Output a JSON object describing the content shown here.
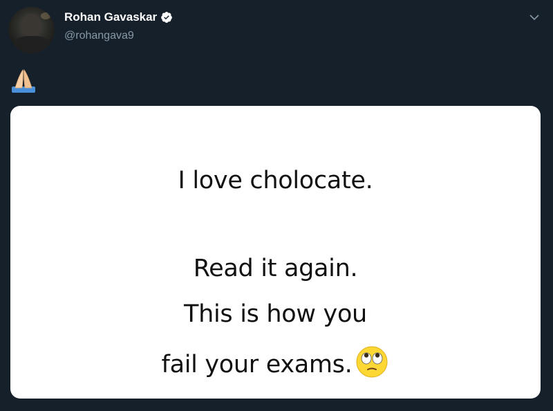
{
  "tweet": {
    "author_name": "Rohan Gavaskar",
    "author_handle": "@rohangava9",
    "verified_icon": "verified-badge-icon",
    "menu_icon": "chevron-down-icon",
    "text_emoji": "folded-hands-emoji",
    "image": {
      "lines": [
        "I love cholocate.",
        "Read it again.",
        "This is how you",
        "fail your exams."
      ],
      "trailing_emoji": "face-with-rolling-eyes-emoji"
    }
  },
  "colors": {
    "background": "#15202b",
    "name": "#ffffff",
    "handle": "#8899a6",
    "card_bg": "#ffffff",
    "card_text": "#111111"
  }
}
